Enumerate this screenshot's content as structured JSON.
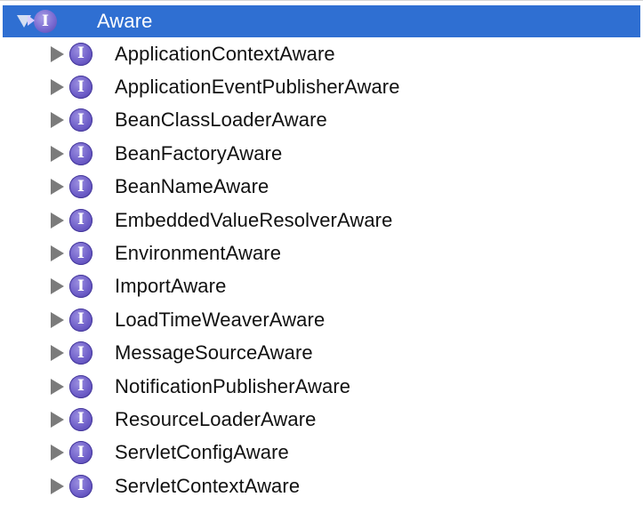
{
  "tree": {
    "root": {
      "label": "Aware",
      "icon": "interface-icon",
      "expanded": true,
      "selected": true,
      "icon_glyph": "I"
    },
    "children": [
      {
        "label": "ApplicationContextAware",
        "icon_glyph": "I"
      },
      {
        "label": "ApplicationEventPublisherAware",
        "icon_glyph": "I"
      },
      {
        "label": "BeanClassLoaderAware",
        "icon_glyph": "I"
      },
      {
        "label": "BeanFactoryAware",
        "icon_glyph": "I"
      },
      {
        "label": "BeanNameAware",
        "icon_glyph": "I"
      },
      {
        "label": "EmbeddedValueResolverAware",
        "icon_glyph": "I"
      },
      {
        "label": "EnvironmentAware",
        "icon_glyph": "I"
      },
      {
        "label": "ImportAware",
        "icon_glyph": "I"
      },
      {
        "label": "LoadTimeWeaverAware",
        "icon_glyph": "I"
      },
      {
        "label": "MessageSourceAware",
        "icon_glyph": "I"
      },
      {
        "label": "NotificationPublisherAware",
        "icon_glyph": "I"
      },
      {
        "label": "ResourceLoaderAware",
        "icon_glyph": "I"
      },
      {
        "label": "ServletConfigAware",
        "icon_glyph": "I"
      },
      {
        "label": "ServletContextAware",
        "icon_glyph": "I"
      }
    ]
  },
  "colors": {
    "selection": "#2f6fd2",
    "disclosure": "#7b7b7b",
    "interface_icon": "#6f5fc9",
    "text": "#111111"
  }
}
